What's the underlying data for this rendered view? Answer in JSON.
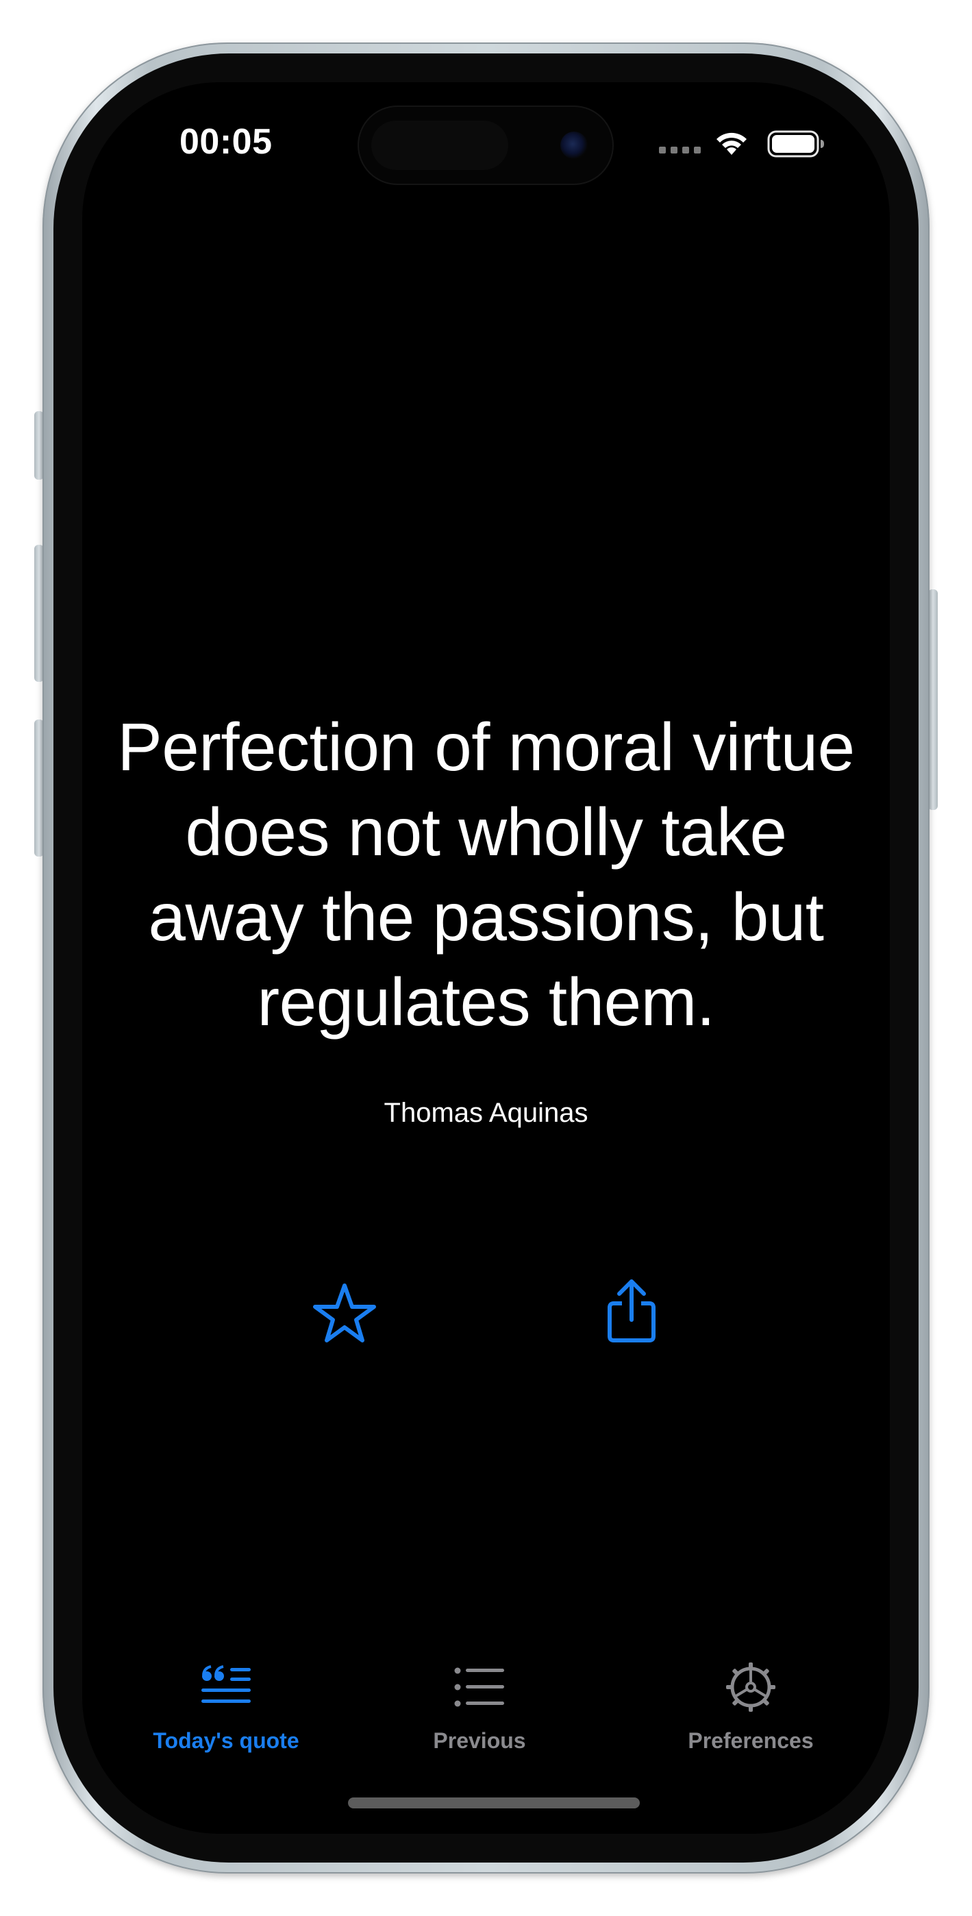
{
  "status_bar": {
    "time": "00:05"
  },
  "quote": {
    "text": "Perfection of moral virtue does not wholly take away the passions, but regulates them.",
    "author": "Thomas Aquinas"
  },
  "actions": {
    "favorite_icon": "star-outline-icon",
    "share_icon": "share-icon"
  },
  "tabs": [
    {
      "label": "Today's quote",
      "icon": "quote-list-icon",
      "selected": true
    },
    {
      "label": "Previous",
      "icon": "list-icon",
      "selected": false
    },
    {
      "label": "Preferences",
      "icon": "gear-icon",
      "selected": false
    }
  ],
  "colors": {
    "accent": "#1a7ef0",
    "inactive": "#8a8a8e",
    "background": "#000000",
    "text": "#ffffff"
  }
}
